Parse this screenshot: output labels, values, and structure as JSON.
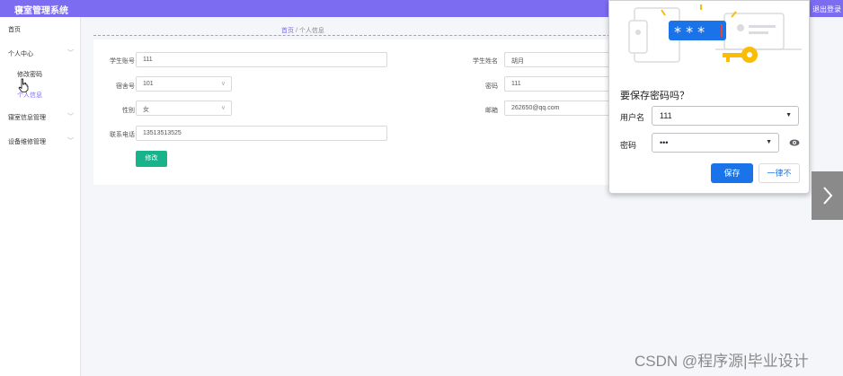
{
  "header": {
    "title": "寝室管理系统",
    "logout_label": "退出登录"
  },
  "sidebar": {
    "items": [
      {
        "label": "首页"
      },
      {
        "label": "个人中心",
        "arrow": "﹀",
        "subitems": [
          {
            "label": "修改密码"
          },
          {
            "label": "个人信息"
          }
        ]
      },
      {
        "label": "寝室信息管理",
        "arrow": "﹀"
      },
      {
        "label": "设备维修管理",
        "arrow": "﹀"
      }
    ]
  },
  "breadcrumb": {
    "home": "首页",
    "separator": "/",
    "current": "个人信息"
  },
  "form": {
    "student_id": {
      "label": "学生账号",
      "value": "111"
    },
    "student_name": {
      "label": "学生姓名",
      "value": "胡月"
    },
    "dorm_no": {
      "label": "宿舍号",
      "value": "101"
    },
    "password": {
      "label": "密码",
      "value": "111"
    },
    "gender": {
      "label": "性别",
      "value": "女"
    },
    "email": {
      "label": "邮箱",
      "value": "262650@qq.com"
    },
    "phone": {
      "label": "联系电话",
      "value": "13513513525"
    },
    "submit_label": "修改"
  },
  "password_popup": {
    "title": "要保存密码吗？",
    "username_label": "用户名",
    "username_value": "111",
    "password_label": "密码",
    "password_value": "•••",
    "save_label": "保存",
    "never_label": "一律不"
  },
  "watermark": "CSDN @程序源|毕业设计",
  "colors": {
    "header": "#7b6cf2",
    "accent": "#7b6cf2",
    "submit": "#17b38a",
    "save": "#1a73e8"
  }
}
